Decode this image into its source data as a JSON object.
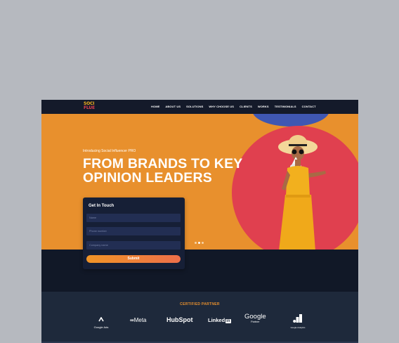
{
  "logo": {
    "line1": "SOCI",
    "line2": "FLUE"
  },
  "nav": {
    "items": [
      "HOME",
      "ABOUT US",
      "SOLUTIONS",
      "WHY CHOOSE US",
      "CLIENTS",
      "WORKS",
      "TESTIMONIALS",
      "CONTACT"
    ]
  },
  "hero": {
    "eyebrow": "Introducing Social Influencer PRO",
    "headline_line1": "FROM BRANDS TO KEY",
    "headline_line2": "OPINION LEADERS"
  },
  "form": {
    "title": "Get In Touch",
    "name_placeholder": "Name",
    "phone_placeholder": "Phone number",
    "company_placeholder": "Company name",
    "submit_label": "Submit"
  },
  "partners": {
    "heading": "CERTIFIED PARTNER",
    "google_ads": "Google Ads",
    "meta": "Meta",
    "hubspot": "HubSpot",
    "linkedin": "Linked",
    "linkedin_in": "in",
    "google": "Google",
    "google_partner": "Partner",
    "google_analytics": "Google Analytics"
  },
  "colors": {
    "orange": "#e8902d",
    "red": "#e0404f",
    "navy": "#111827",
    "blue": "#3f57b2",
    "yellow": "#f2b01e"
  }
}
